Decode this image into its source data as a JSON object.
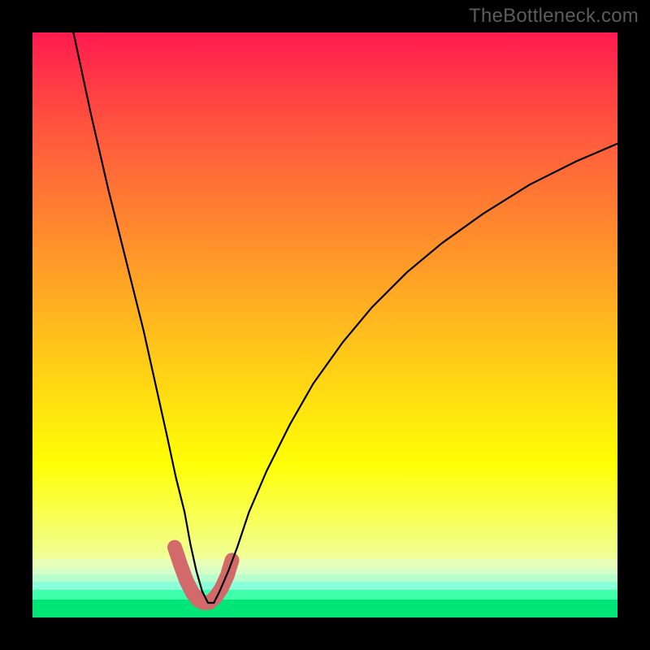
{
  "watermark": "TheBottleneck.com",
  "chart_data": {
    "type": "line",
    "title": "",
    "xlabel": "",
    "ylabel": "",
    "xlim": [
      0,
      100
    ],
    "ylim": [
      0,
      100
    ],
    "grid": false,
    "legend": false,
    "series": [
      {
        "name": "curve",
        "color": "#000000",
        "stroke_width": 2,
        "x": [
          7,
          10,
          13,
          16,
          19,
          21,
          23,
          24.5,
          26,
          27,
          28,
          29,
          30,
          31,
          32,
          33.5,
          35,
          37,
          40,
          44,
          48,
          53,
          58,
          64,
          70,
          77,
          85,
          93,
          100
        ],
        "y": [
          100,
          86,
          73,
          61,
          49,
          40,
          31,
          24,
          18,
          12.5,
          8,
          4.5,
          2.5,
          2.5,
          4.5,
          8,
          12,
          18,
          25,
          33,
          40,
          47,
          53,
          59,
          64,
          69,
          74,
          78,
          81
        ]
      },
      {
        "name": "highlight",
        "color": "#d36a6a",
        "stroke_width": 12,
        "linecap": "round",
        "x": [
          24.3,
          25.3,
          26.3,
          27.3,
          28.3,
          29.3,
          30.3,
          31.3,
          32.3,
          33.3,
          34.1
        ],
        "y": [
          12.0,
          9.0,
          6.3,
          4.3,
          3.0,
          2.5,
          2.6,
          3.5,
          5.0,
          7.2,
          9.8
        ]
      }
    ],
    "background": {
      "type": "vertical-gradient",
      "stops": [
        {
          "pos": 0.0,
          "color": "#ff1a4f"
        },
        {
          "pos": 0.5,
          "color": "#ffa026"
        },
        {
          "pos": 0.82,
          "color": "#ffff05"
        },
        {
          "pos": 0.93,
          "color": "#d8ffc8"
        },
        {
          "pos": 1.0,
          "color": "#00e676"
        }
      ]
    }
  }
}
